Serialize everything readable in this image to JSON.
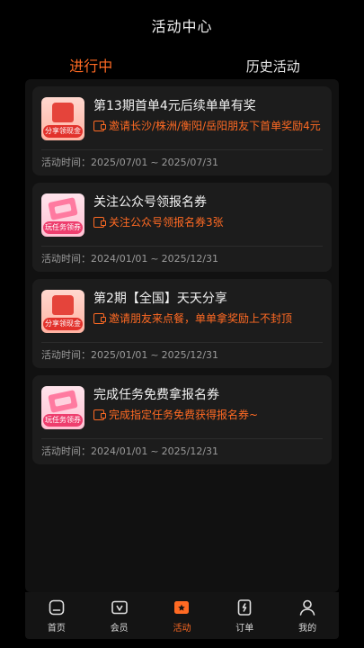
{
  "header": {
    "title": "活动中心"
  },
  "tabs": [
    {
      "label": "进行中",
      "active": true
    },
    {
      "label": "历史活动",
      "active": false
    }
  ],
  "activities": [
    {
      "title": "第13期首单4元后续单单有奖",
      "desc": "邀请长沙/株洲/衡阳/岳阳朋友下首单奖励4元",
      "time_label": "活动时间：",
      "start": "2025/07/01",
      "end": "2025/07/31",
      "thumb_badge": "分享领现金",
      "thumb_style": "red"
    },
    {
      "title": "关注公众号领报名券",
      "desc": "关注公众号领报名券3张",
      "time_label": "活动时间：",
      "start": "2024/01/01",
      "end": "2025/12/31",
      "thumb_badge": "玩任务领券",
      "thumb_style": "pink"
    },
    {
      "title": "第2期【全国】天天分享",
      "desc": "邀请朋友来点餐，单单拿奖励上不封顶",
      "time_label": "活动时间：",
      "start": "2025/01/01",
      "end": "2025/12/31",
      "thumb_badge": "分享领现金",
      "thumb_style": "red"
    },
    {
      "title": "完成任务免费拿报名券",
      "desc": "完成指定任务免费获得报名券~",
      "time_label": "活动时间：",
      "start": "2024/01/01",
      "end": "2025/12/31",
      "thumb_badge": "玩任务领券",
      "thumb_style": "pink"
    }
  ],
  "time_separator": "~",
  "tabbar": [
    {
      "label": "首页",
      "icon": "home-icon",
      "active": false
    },
    {
      "label": "会员",
      "icon": "vip-icon",
      "active": false
    },
    {
      "label": "活动",
      "icon": "activity-icon",
      "active": true
    },
    {
      "label": "订单",
      "icon": "order-icon",
      "active": false
    },
    {
      "label": "我的",
      "icon": "profile-icon",
      "active": false
    }
  ],
  "colors": {
    "accent": "#ff6a23",
    "background": "#000000",
    "card": "#1c1c1c"
  }
}
